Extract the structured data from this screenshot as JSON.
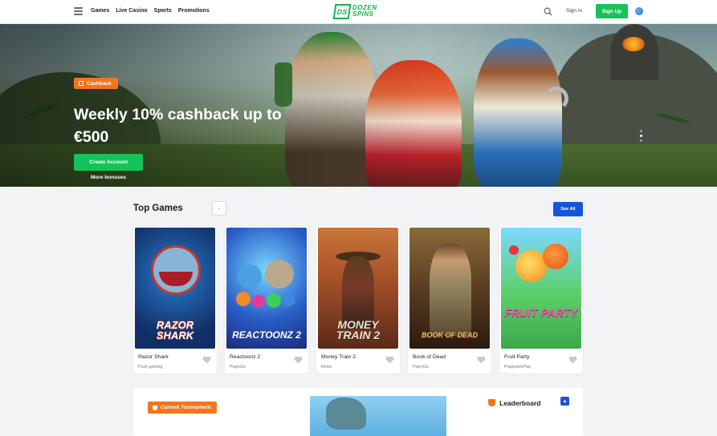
{
  "header": {
    "nav": [
      "Games",
      "Live Casino",
      "Sports",
      "Promotions"
    ],
    "logo_line1": "DOZEN",
    "logo_line2": "SPINS",
    "logo_mark": "DS",
    "signin": "Sign In",
    "signup": "Sign Up"
  },
  "hero": {
    "badge": "Cashback",
    "title": "Weekly 10% cashback up to €500",
    "cta": "Create Account",
    "more": "More bonuses",
    "slides": 3,
    "active_slide": 1
  },
  "top_games": {
    "title": "Top Games",
    "see_all": "See All",
    "next_arrow": "›",
    "games": [
      {
        "name": "Razor Shark",
        "provider": "Push gaming",
        "thumb_text": "RAZOR SHARK"
      },
      {
        "name": "Reactoonz 2",
        "provider": "PlaynGo",
        "thumb_text": "REACTOONZ 2"
      },
      {
        "name": "Money Train 2",
        "provider": "Relax",
        "thumb_text": "MONEY TRAIN 2"
      },
      {
        "name": "Book of Dead",
        "provider": "PlaynGo",
        "thumb_text": "BOOK OF DEAD"
      },
      {
        "name": "Fruit Party",
        "provider": "PragmaticPlay",
        "thumb_text": "FRUIT PARTY"
      }
    ]
  },
  "tournament": {
    "badge": "Current Tournament",
    "leaderboard": "Leaderboard"
  },
  "colors": {
    "green": "#16c25a",
    "orange": "#f1761f",
    "blue": "#1556d8"
  }
}
